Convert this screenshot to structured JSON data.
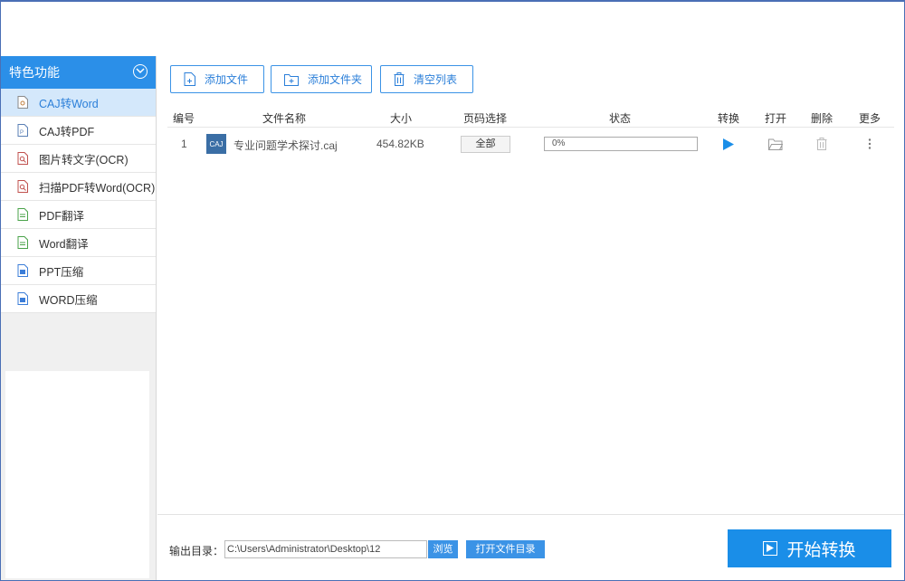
{
  "sidebar": {
    "title": "特色功能",
    "items": [
      {
        "label": "CAJ转Word",
        "icon": "caj-doc-icon",
        "active": true
      },
      {
        "label": "CAJ转PDF",
        "icon": "pdf-doc-icon",
        "active": false
      },
      {
        "label": "图片转文字(OCR)",
        "icon": "image-ocr-icon",
        "active": false
      },
      {
        "label": "扫描PDF转Word(OCR)",
        "icon": "scan-ocr-icon",
        "active": false
      },
      {
        "label": "PDF翻译",
        "icon": "pdf-translate-icon",
        "active": false
      },
      {
        "label": "Word翻译",
        "icon": "word-translate-icon",
        "active": false
      },
      {
        "label": "PPT压缩",
        "icon": "ppt-compress-icon",
        "active": false
      },
      {
        "label": "WORD压缩",
        "icon": "word-compress-icon",
        "active": false
      }
    ]
  },
  "toolbar": {
    "add_file": "添加文件",
    "add_folder": "添加文件夹",
    "clear_list": "清空列表"
  },
  "table": {
    "headers": {
      "index": "编号",
      "filename": "文件名称",
      "size": "大小",
      "page_select": "页码选择",
      "status": "状态",
      "convert": "转换",
      "open": "打开",
      "delete": "删除",
      "more": "更多"
    },
    "rows": [
      {
        "index": "1",
        "file_icon_label": "CAJ",
        "filename": "专业问题学术探讨.caj",
        "size": "454.82KB",
        "page_select": "全部",
        "progress_text": "0%",
        "progress": 0
      }
    ]
  },
  "footer": {
    "output_label": "输出目录：",
    "output_path": "C:\\Users\\Administrator\\Desktop\\12",
    "browse": "浏览",
    "open_dir": "打开文件目录",
    "start": "开始转换"
  },
  "colors": {
    "accent": "#2b8fe8",
    "active_bg": "#d4e8fb",
    "start_button": "#1a8ee8"
  }
}
